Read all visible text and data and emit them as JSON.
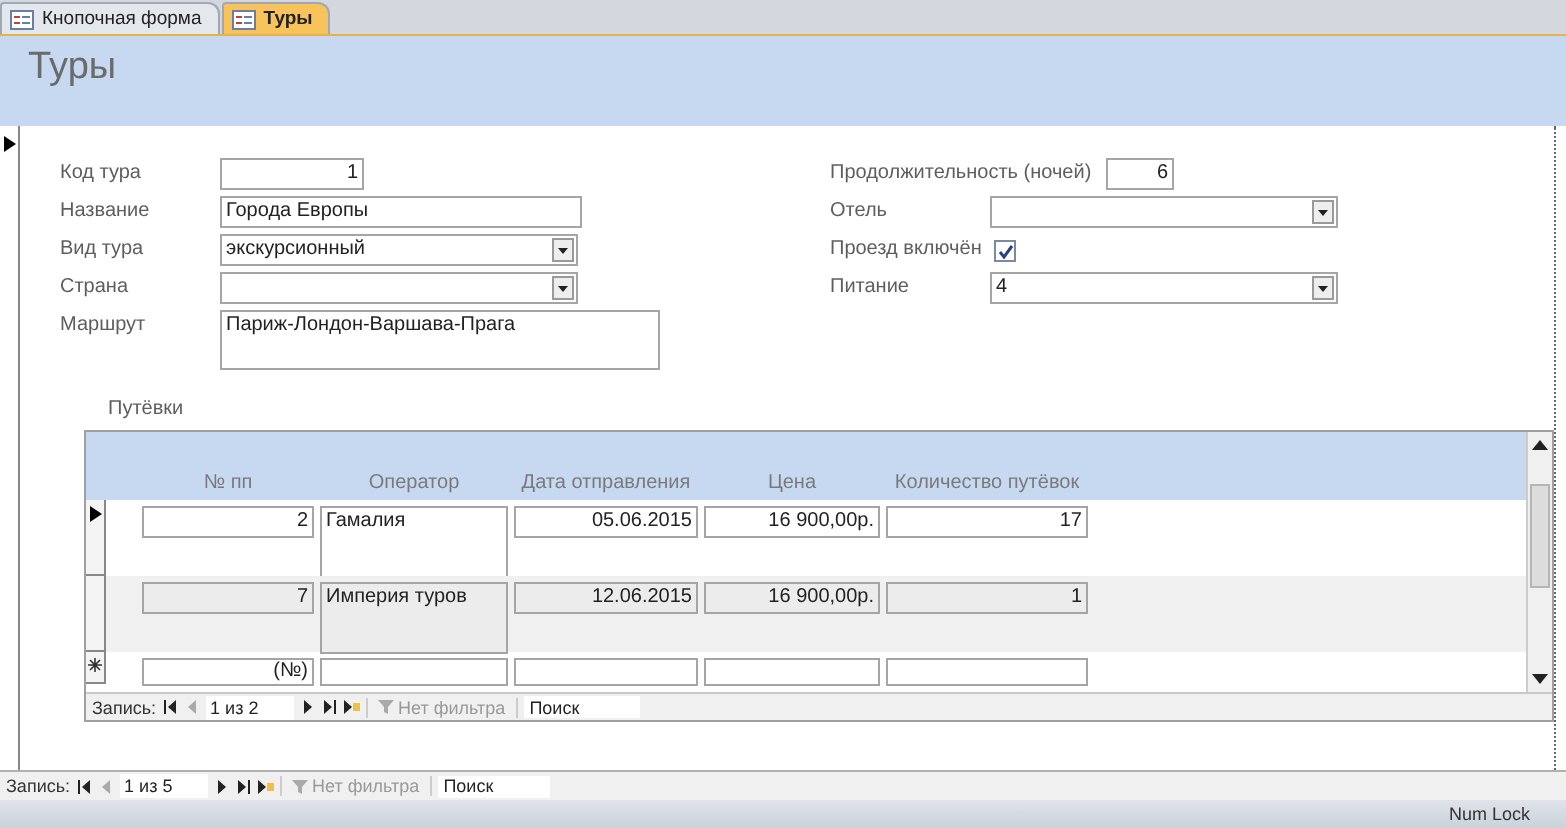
{
  "tabs": [
    {
      "label": "Кнопочная форма",
      "selected": false
    },
    {
      "label": "Туры",
      "selected": true
    }
  ],
  "form": {
    "title": "Туры",
    "left_fields": [
      {
        "label": "Код тура",
        "kind": "number",
        "value": "1"
      },
      {
        "label": "Название",
        "kind": "text",
        "value": "Города Европы"
      },
      {
        "label": "Вид тура",
        "kind": "combo",
        "value": "экскурсионный"
      },
      {
        "label": "Страна",
        "kind": "combo"
      },
      {
        "label": "Маршрут",
        "kind": "memo",
        "value": "Париж-Лондон-Варшава-Прага"
      }
    ],
    "right_fields": [
      {
        "label": "Продолжительность (ночей)",
        "kind": "number",
        "value": "6"
      },
      {
        "label": "Отель",
        "kind": "combo"
      },
      {
        "label": "Проезд включён",
        "kind": "checkbox",
        "checked": true
      },
      {
        "label": "Питание",
        "kind": "combo",
        "value": "4"
      }
    ],
    "subform": {
      "label": "Путёвки",
      "columns": [
        "№ пп",
        "Оператор",
        "Дата отправления",
        "Цена",
        "Количество путёвок"
      ],
      "rows": [
        {
          "kind": "record",
          "selected": true,
          "cells": [
            "2",
            "Гамалия",
            "05.06.2015",
            "16 900,00р.",
            "17"
          ]
        },
        {
          "kind": "record",
          "selected": false,
          "cells": [
            "7",
            "Империя туров",
            "12.06.2015",
            "16 900,00р.",
            "1"
          ]
        },
        {
          "kind": "new",
          "selected": false,
          "cells": [
            "(№)"
          ]
        }
      ],
      "nav": {
        "label": "Запись:",
        "position": "1 из 2",
        "filter": "Нет фильтра",
        "search_placeholder": "Поиск"
      }
    }
  },
  "nav": {
    "label": "Запись:",
    "position": "1 из 5",
    "filter": "Нет фильтра",
    "search_placeholder": "Поиск"
  },
  "status_bar": {
    "num_lock": "Num Lock"
  }
}
